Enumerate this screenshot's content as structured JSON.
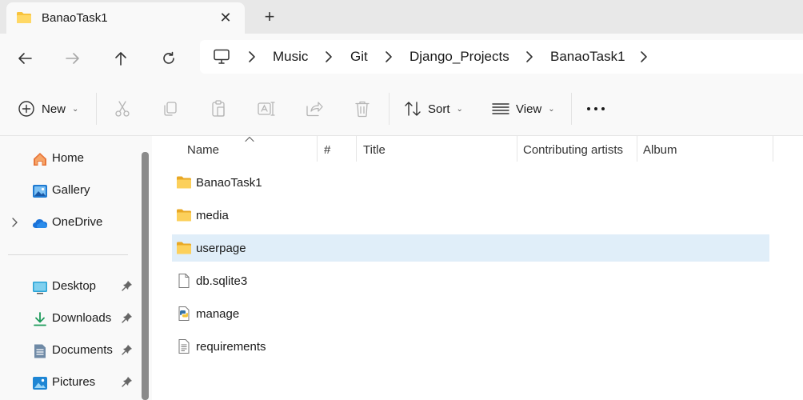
{
  "tab": {
    "title": "BanaoTask1",
    "close": "✕",
    "new_tab": "+"
  },
  "breadcrumb": [
    "Music",
    "Git",
    "Django_Projects",
    "BanaoTask1"
  ],
  "toolbar": {
    "new_label": "New",
    "sort_label": "Sort",
    "view_label": "View"
  },
  "sidebar": {
    "items": [
      {
        "label": "Home",
        "icon": "home-icon"
      },
      {
        "label": "Gallery",
        "icon": "gallery-icon"
      },
      {
        "label": "OneDrive",
        "icon": "onedrive-icon",
        "expandable": true
      }
    ],
    "pinned": [
      {
        "label": "Desktop",
        "icon": "desktop-icon"
      },
      {
        "label": "Downloads",
        "icon": "downloads-icon"
      },
      {
        "label": "Documents",
        "icon": "documents-icon"
      },
      {
        "label": "Pictures",
        "icon": "pictures-icon"
      }
    ]
  },
  "columns": [
    "Name",
    "#",
    "Title",
    "Contributing artists",
    "Album"
  ],
  "files": [
    {
      "name": "BanaoTask1",
      "type": "folder"
    },
    {
      "name": "media",
      "type": "folder"
    },
    {
      "name": "userpage",
      "type": "folder",
      "selected": true
    },
    {
      "name": "db.sqlite3",
      "type": "file"
    },
    {
      "name": "manage",
      "type": "python"
    },
    {
      "name": "requirements",
      "type": "text"
    }
  ],
  "colors": {
    "folder": "#f8c33c",
    "selection": "#e0eef9",
    "accent": "#0067c0"
  }
}
